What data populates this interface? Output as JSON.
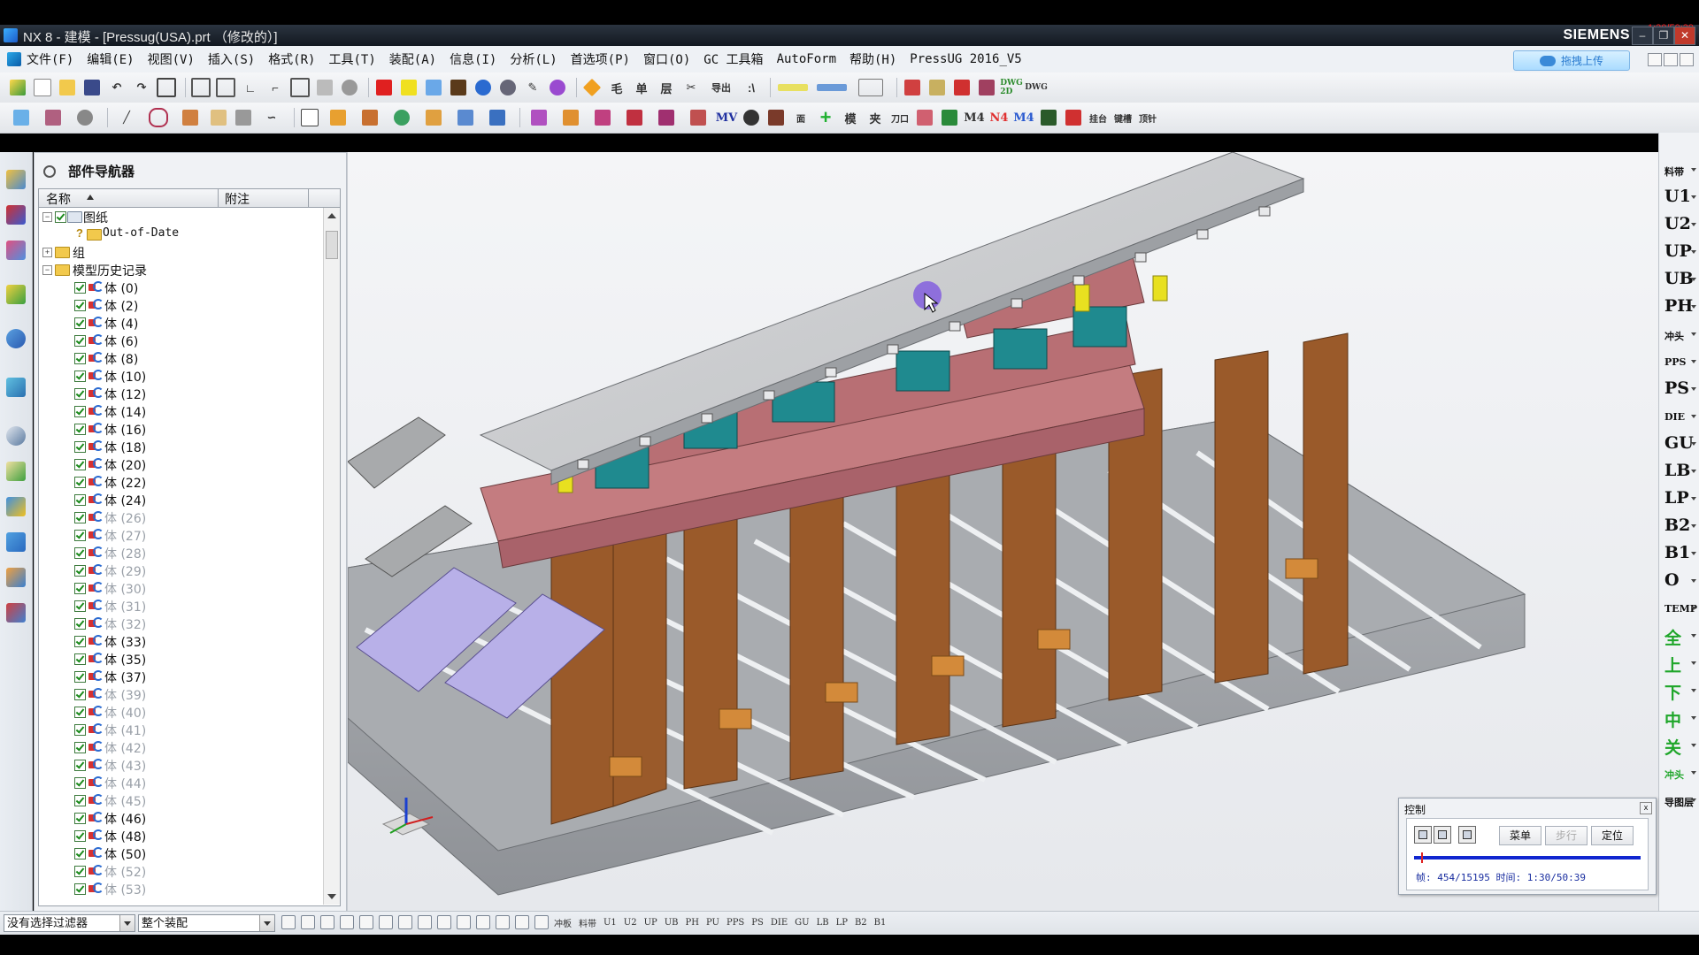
{
  "window": {
    "title": "NX 8 - 建模 - [Pressug(USA).prt （修改的）]",
    "brand": "SIEMENS",
    "corner_text": "1:30/50:39"
  },
  "menu": {
    "items": [
      "文件(F)",
      "编辑(E)",
      "视图(V)",
      "插入(S)",
      "格式(R)",
      "工具(T)",
      "装配(A)",
      "信息(I)",
      "分析(L)",
      "首选项(P)",
      "窗口(O)",
      "GC 工具箱",
      "AutoForm",
      "帮助(H)",
      "PressUG 2016_V5"
    ],
    "upload_label": "拖拽上传"
  },
  "toolbar1": {
    "text_buttons": [
      "毛",
      "单",
      "层",
      "导出",
      "DWG 2D",
      "DWG"
    ],
    "accent": "#e02020"
  },
  "toolbar2": {
    "text_buttons": [
      "MV",
      "面",
      "模",
      "夹",
      "刀口",
      "M4",
      "N4",
      "M4",
      "挂台",
      "键槽",
      "顶针"
    ]
  },
  "navigator": {
    "title": "部件导航器",
    "col_name": "名称",
    "col_note": "附注",
    "rows": [
      {
        "label": "图纸",
        "kind": "drawing",
        "level": 0,
        "expanded": true
      },
      {
        "label": "Out-of-Date",
        "kind": "outdated",
        "level": 1
      },
      {
        "label": "组",
        "kind": "folder",
        "level": 0,
        "expanded": false
      },
      {
        "label": "模型历史记录",
        "kind": "folder",
        "level": 0,
        "expanded": true
      },
      {
        "label": "体 (0)",
        "kind": "body",
        "dim": false
      },
      {
        "label": "体 (2)",
        "kind": "body",
        "dim": false
      },
      {
        "label": "体 (4)",
        "kind": "body",
        "dim": false
      },
      {
        "label": "体 (6)",
        "kind": "body",
        "dim": false
      },
      {
        "label": "体 (8)",
        "kind": "body",
        "dim": false
      },
      {
        "label": "体 (10)",
        "kind": "body",
        "dim": false
      },
      {
        "label": "体 (12)",
        "kind": "body",
        "dim": false
      },
      {
        "label": "体 (14)",
        "kind": "body",
        "dim": false
      },
      {
        "label": "体 (16)",
        "kind": "body",
        "dim": false
      },
      {
        "label": "体 (18)",
        "kind": "body",
        "dim": false
      },
      {
        "label": "体 (20)",
        "kind": "body",
        "dim": false
      },
      {
        "label": "体 (22)",
        "kind": "body",
        "dim": false
      },
      {
        "label": "体 (24)",
        "kind": "body",
        "dim": false
      },
      {
        "label": "体 (26)",
        "kind": "body",
        "dim": true
      },
      {
        "label": "体 (27)",
        "kind": "body",
        "dim": true
      },
      {
        "label": "体 (28)",
        "kind": "body",
        "dim": true
      },
      {
        "label": "体 (29)",
        "kind": "body",
        "dim": true
      },
      {
        "label": "体 (30)",
        "kind": "body",
        "dim": true
      },
      {
        "label": "体 (31)",
        "kind": "body",
        "dim": true
      },
      {
        "label": "体 (32)",
        "kind": "body",
        "dim": true
      },
      {
        "label": "体 (33)",
        "kind": "body",
        "dim": false
      },
      {
        "label": "体 (35)",
        "kind": "body",
        "dim": false
      },
      {
        "label": "体 (37)",
        "kind": "body",
        "dim": false
      },
      {
        "label": "体 (39)",
        "kind": "body",
        "dim": true
      },
      {
        "label": "体 (40)",
        "kind": "body",
        "dim": true
      },
      {
        "label": "体 (41)",
        "kind": "body",
        "dim": true
      },
      {
        "label": "体 (42)",
        "kind": "body",
        "dim": true
      },
      {
        "label": "体 (43)",
        "kind": "body",
        "dim": true
      },
      {
        "label": "体 (44)",
        "kind": "body",
        "dim": true
      },
      {
        "label": "体 (45)",
        "kind": "body",
        "dim": true
      },
      {
        "label": "体 (46)",
        "kind": "body",
        "dim": false
      },
      {
        "label": "体 (48)",
        "kind": "body",
        "dim": false
      },
      {
        "label": "体 (50)",
        "kind": "body",
        "dim": false
      },
      {
        "label": "体 (52)",
        "kind": "body",
        "dim": true
      },
      {
        "label": "体 (53)",
        "kind": "body",
        "dim": true
      }
    ]
  },
  "rightbar": {
    "buttons": [
      {
        "label": "料带",
        "small": true,
        "green": false
      },
      {
        "label": "U1",
        "small": false,
        "green": false
      },
      {
        "label": "U2",
        "small": false,
        "green": false
      },
      {
        "label": "UP",
        "small": false,
        "green": false
      },
      {
        "label": "UB",
        "small": false,
        "green": false
      },
      {
        "label": "PH",
        "small": false,
        "green": false
      },
      {
        "label": "冲头",
        "small": true,
        "green": false
      },
      {
        "label": "PPS",
        "small": true,
        "green": false
      },
      {
        "label": "PS",
        "small": false,
        "green": false
      },
      {
        "label": "DIE",
        "small": true,
        "green": false
      },
      {
        "label": "GU",
        "small": false,
        "green": false
      },
      {
        "label": "LB",
        "small": false,
        "green": false
      },
      {
        "label": "LP",
        "small": false,
        "green": false
      },
      {
        "label": "B2",
        "small": false,
        "green": false
      },
      {
        "label": "B1",
        "small": false,
        "green": false
      },
      {
        "label": "O",
        "small": false,
        "green": false
      },
      {
        "label": "TEMP",
        "small": true,
        "green": false
      },
      {
        "label": "全",
        "small": false,
        "green": true
      },
      {
        "label": "上",
        "small": false,
        "green": true
      },
      {
        "label": "下",
        "small": false,
        "green": true
      },
      {
        "label": "中",
        "small": false,
        "green": true
      },
      {
        "label": "关",
        "small": false,
        "green": true
      },
      {
        "label": "冲头",
        "small": true,
        "green": true
      },
      {
        "label": "导图层",
        "small": true,
        "green": false
      }
    ]
  },
  "control": {
    "title": "控制",
    "btn_menu": "菜单",
    "btn_step": "步行",
    "btn_locate": "定位",
    "status": "帧: 454/15195 时间: 1:30/50:39",
    "progress": 0.03
  },
  "bottombar": {
    "filter_value": "没有选择过滤器",
    "scope_value": "整个装配",
    "filter_labels": [
      "冲板",
      "料带",
      "U1",
      "U2",
      "UP",
      "UB",
      "PH",
      "PU",
      "PPS",
      "PS",
      "DIE",
      "GU",
      "LB",
      "LP",
      "B2",
      "B1"
    ]
  },
  "colors": {
    "plate_pink": "#b86f74",
    "leg_brown": "#9a5a2a",
    "base_gray": "#9b9ea2",
    "teal": "#1f8a8f",
    "yellow": "#e8e020",
    "purple_sheet": "#b8b0e8"
  }
}
